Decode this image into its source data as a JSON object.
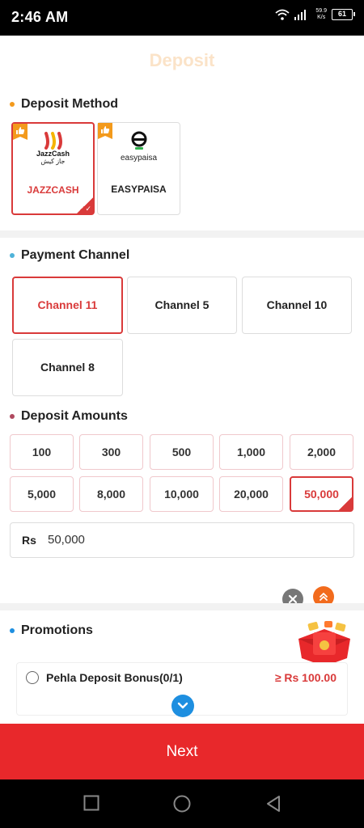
{
  "status_bar": {
    "time": "2:46 AM",
    "net_speed_value": "59.9",
    "net_speed_unit": "K/s",
    "battery": "61"
  },
  "page": {
    "title": "Deposit"
  },
  "deposit_method": {
    "title": "Deposit Method",
    "dot_color": "#f39a1c",
    "options": [
      {
        "label": "JAZZCASH",
        "logo_text": "JazzCash",
        "logo_subtext": "جاز کیش",
        "selected": true
      },
      {
        "label": "EASYPAISA",
        "logo_text": "easypaisa",
        "selected": false
      }
    ]
  },
  "payment_channel": {
    "title": "Payment Channel",
    "dot_color": "#4fb3d9",
    "channels": [
      {
        "label": "Channel 11",
        "selected": true
      },
      {
        "label": "Channel 5",
        "selected": false
      },
      {
        "label": "Channel 10",
        "selected": false
      },
      {
        "label": "Channel 8",
        "selected": false
      }
    ]
  },
  "deposit_amounts": {
    "title": "Deposit Amounts",
    "dot_color": "#b0495f",
    "amounts": [
      "100",
      "300",
      "500",
      "1,000",
      "2,000",
      "5,000",
      "8,000",
      "10,000",
      "20,000",
      "50,000"
    ],
    "selected": "50,000",
    "input": {
      "currency": "Rs",
      "value": "50,000"
    }
  },
  "promotions": {
    "title": "Promotions",
    "dot_color": "#1e8fe0",
    "items": [
      {
        "title": "Pehla Deposit Bonus(0/1)",
        "amount": "≥ Rs 100.00"
      }
    ]
  },
  "footer": {
    "next_label": "Next"
  },
  "colors": {
    "accent": "#d93a3a",
    "next_button": "#e8282b",
    "divider": "#f2f2f2"
  },
  "icons": [
    "wifi-icon",
    "signal-icon",
    "battery-icon",
    "thumbs-up-icon",
    "checkmark-icon",
    "close-icon",
    "double-chevron-up-icon",
    "gift-icon",
    "chevron-down-icon",
    "nav-square-icon",
    "nav-circle-icon",
    "nav-back-icon"
  ]
}
